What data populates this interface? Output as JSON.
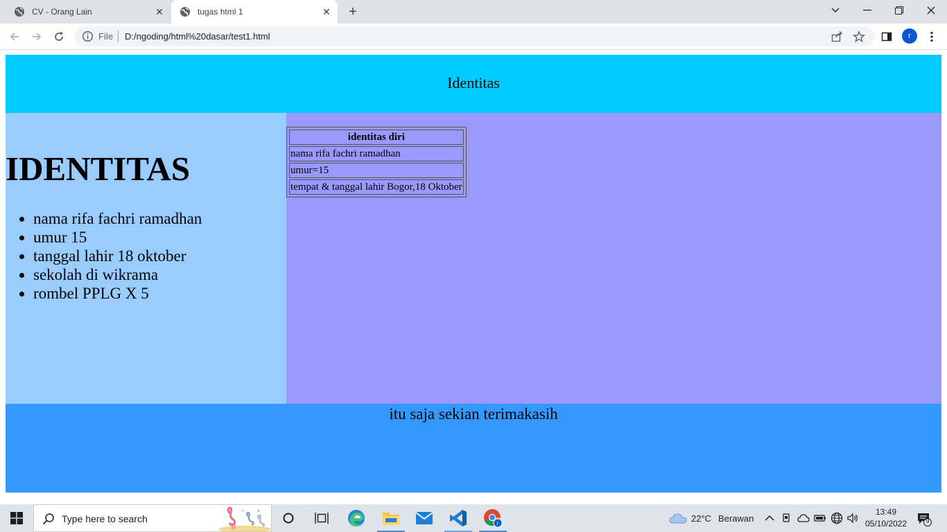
{
  "browser": {
    "tabs": [
      {
        "title": "CV - Orang Lain",
        "active": false
      },
      {
        "title": "tugas html 1",
        "active": true
      }
    ],
    "address": {
      "scheme": "File",
      "url": "D:/ngoding/html%20dasar/test1.html"
    },
    "profile_initial": "r"
  },
  "page": {
    "header_title": "Identitas",
    "big_heading": "IDENTITAS",
    "list_items": [
      "nama rifa fachri ramadhan",
      "umur 15",
      "tanggal lahir 18 oktober",
      "sekolah di wikrama",
      "rombel PPLG X 5"
    ],
    "table": {
      "header": "identitas diri",
      "rows": [
        "nama rifa fachri ramadhan",
        "umur=15",
        "tempat & tanggal lahir Bogor,18 Oktober"
      ]
    },
    "footer_text": "itu saja sekian terimakasih",
    "colors": {
      "header_bg": "#00ccff",
      "left_bg": "#99ccff",
      "right_bg": "#9999ff",
      "footer_bg": "#3399ff"
    }
  },
  "taskbar": {
    "search_placeholder": "Type here to search",
    "weather": {
      "temp": "22°C",
      "condition": "Berawan"
    },
    "time": "13:49",
    "date": "05/10/2022",
    "notification_count": "9",
    "pinned_apps": [
      "task-view-icon",
      "edge-icon",
      "file-explorer-icon",
      "mail-icon",
      "vscode-icon",
      "chrome-icon"
    ]
  }
}
